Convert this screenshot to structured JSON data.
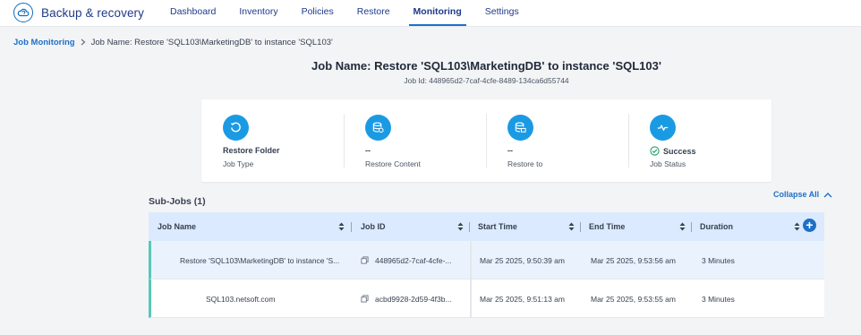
{
  "app": {
    "title": "Backup & recovery",
    "nav_tabs": [
      {
        "label": "Dashboard",
        "active": false
      },
      {
        "label": "Inventory",
        "active": false
      },
      {
        "label": "Policies",
        "active": false
      },
      {
        "label": "Restore",
        "active": false
      },
      {
        "label": "Monitoring",
        "active": true
      },
      {
        "label": "Settings",
        "active": false
      }
    ]
  },
  "breadcrumb": {
    "parent": "Job Monitoring",
    "current": "Job Name: Restore 'SQL103\\MarketingDB' to instance 'SQL103'"
  },
  "header": {
    "title": "Job Name: Restore 'SQL103\\MarketingDB' to instance 'SQL103'",
    "job_id": "Job Id: 448965d2-7caf-4cfe-8489-134ca6d55744"
  },
  "summary": [
    {
      "icon": "restore-icon",
      "value": "Restore Folder",
      "label": "Job Type"
    },
    {
      "icon": "database-icon",
      "value": "--",
      "label": "Restore Content"
    },
    {
      "icon": "database-target-icon",
      "value": "--",
      "label": "Restore to"
    },
    {
      "icon": "activity-icon",
      "value": "Success",
      "label": "Job Status"
    }
  ],
  "subjobs": {
    "title": "Sub-Jobs (1)",
    "collapse_label": "Collapse All",
    "columns": [
      "Job Name",
      "Job ID",
      "Start Time",
      "End Time",
      "Duration"
    ],
    "rows": [
      {
        "name": "Restore 'SQL103\\MarketingDB' to instance 'S...",
        "id": "448965d2-7caf-4cfe-...",
        "start": "Mar 25 2025, 9:50:39 am",
        "end": "Mar 25 2025, 9:53:56 am",
        "duration": "3 Minutes"
      },
      {
        "name": "SQL103.netsoft.com",
        "id": "acbd9928-2d59-4f3b...",
        "start": "Mar 25 2025, 9:51:13 am",
        "end": "Mar 25 2025, 9:53:55 am",
        "duration": "3 Minutes"
      }
    ]
  },
  "colors": {
    "accent": "#1e6fc7",
    "icon_bg": "#1b9ae4",
    "success": "#22a06b",
    "row_marker": "#58c7b9",
    "header_bg": "#dbeafe"
  }
}
